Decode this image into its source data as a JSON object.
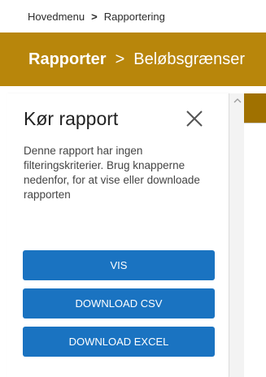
{
  "breadcrumb": {
    "home": "Hovedmenu",
    "separator": ">",
    "current": "Rapportering"
  },
  "titlebar": {
    "section": "Rapporter",
    "separator": ">",
    "page": "Beløbsgrænser"
  },
  "panel": {
    "title": "Kør rapport",
    "description": "Denne rapport har ingen filteringskriterier. Brug knapperne nedenfor, for at vise eller downloade rapporten",
    "buttons": {
      "view": "VIS",
      "csv": "DOWNLOAD CSV",
      "excel": "DOWNLOAD EXCEL"
    }
  },
  "colors": {
    "header_gold": "#b8860b",
    "button_blue": "#1a73c1"
  }
}
